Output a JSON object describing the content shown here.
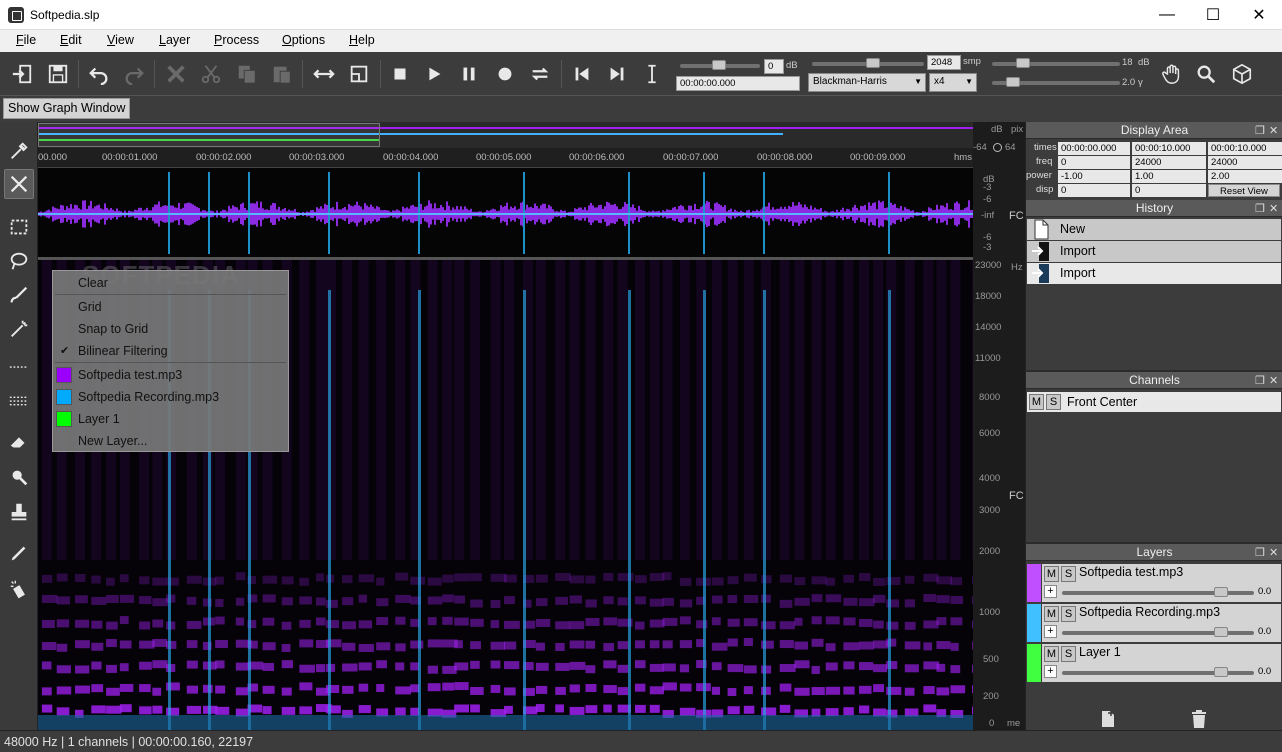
{
  "window": {
    "title": "Softpedia.slp",
    "minimize": "—",
    "maximize": "☐",
    "close": "✕"
  },
  "menu": [
    "File",
    "Edit",
    "View",
    "Layer",
    "Process",
    "Options",
    "Help"
  ],
  "toolbar": {
    "gain_value": "0",
    "gain_unit": "dB",
    "time_value": "00:00:00.000",
    "fft_size": "2048",
    "fft_unit": "smp",
    "window_fn": "Blackman-Harris",
    "oversample": "x4",
    "range_value": "18",
    "range_unit": "dB",
    "gamma_value": "2.0",
    "gamma_unit": "γ"
  },
  "show_graph_button": "Show Graph Window",
  "ruler": {
    "ticks": [
      "00.000",
      "00:00:01.000",
      "00:00:02.000",
      "00:00:03.000",
      "00:00:04.000",
      "00:00:05.000",
      "00:00:06.000",
      "00:00:07.000",
      "00:00:08.000",
      "00:00:09.000"
    ],
    "unit": "hms"
  },
  "wave_scale": [
    "-3",
    "-6",
    "-inf",
    "-6",
    "-3"
  ],
  "wave_top_labels": [
    "dB",
    "pix",
    "-64",
    "64",
    "dB"
  ],
  "wave_channel": "FC",
  "spec_scale": [
    "23000",
    "18000",
    "14000",
    "11000",
    "8000",
    "6000",
    "4000",
    "3000",
    "2000",
    "1000",
    "500",
    "200",
    "0"
  ],
  "spec_unit": "Hz",
  "spec_channel": "FC",
  "spec_bottom_label": "me",
  "watermark": "SOFTPEDIA",
  "context_menu": {
    "items": [
      "Clear",
      "Grid",
      "Snap to Grid",
      "Bilinear Filtering"
    ],
    "checked": "✔",
    "layers": [
      {
        "name": "Softpedia test.mp3",
        "color": "#9b00ff"
      },
      {
        "name": "Softpedia Recording.mp3",
        "color": "#00aaff"
      },
      {
        "name": "Layer 1",
        "color": "#00ff00"
      }
    ],
    "new_layer": "New Layer..."
  },
  "display_area": {
    "title": "Display Area",
    "rows": [
      {
        "label": "times",
        "values": [
          "00:00:00.000",
          "00:00:10.000",
          "00:00:10.000"
        ]
      },
      {
        "label": "freq",
        "values": [
          "0",
          "24000",
          "24000"
        ]
      },
      {
        "label": "power",
        "values": [
          "-1.00",
          "1.00",
          "2.00"
        ]
      },
      {
        "label": "disp",
        "values": [
          "0",
          "0"
        ]
      }
    ],
    "reset": "Reset View"
  },
  "history": {
    "title": "History",
    "items": [
      "New",
      "Import",
      "Import"
    ]
  },
  "channels": {
    "title": "Channels",
    "items": [
      {
        "m": "M",
        "s": "S",
        "name": "Front Center"
      }
    ]
  },
  "layers": {
    "title": "Layers",
    "items": [
      {
        "name": "Softpedia test.mp3",
        "color": "#c050ff",
        "value": "0.0",
        "plus": "+"
      },
      {
        "name": "Softpedia Recording.mp3",
        "color": "#40c0ff",
        "value": "0.0",
        "plus": "+"
      },
      {
        "name": "Layer 1",
        "color": "#40ff40",
        "value": "0.0",
        "plus": "+"
      }
    ]
  },
  "panel_buttons": {
    "float": "❐",
    "close": "✕"
  },
  "status": "48000 Hz | 1 channels | 00:00:00.160, 22197"
}
